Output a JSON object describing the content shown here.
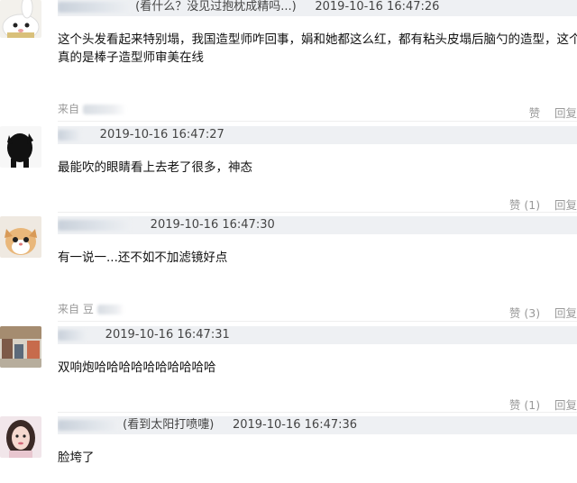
{
  "comments": [
    {
      "nickname": "(看什么？没见过抱枕成精吗...)",
      "time": "2019-10-16 16:47:26",
      "text_line1": "这个头发看起来特别塌，我国造型师咋回事，娟和她都这么红，都有粘头皮塌后脑勺的造型，这个",
      "text_line2": "真的是棒子造型师审美在线",
      "source_label": "来自",
      "like_label": "赞",
      "reply_label": "回复"
    },
    {
      "nickname": "",
      "time": "2019-10-16 16:47:27",
      "text_line1": "最能吹的眼睛看上去老了很多，神态",
      "like_label": "赞 (1)",
      "reply_label": "回复"
    },
    {
      "nickname": "",
      "time": "2019-10-16 16:47:30",
      "text_line1": "有一说一...还不如不加滤镜好点",
      "source_label": "来自 豆",
      "like_label": "赞 (3)",
      "reply_label": "回复"
    },
    {
      "nickname": "",
      "time": "2019-10-16 16:47:31",
      "text_line1": "双响炮哈哈哈哈哈哈哈哈哈哈",
      "like_label": "赞 (1)",
      "reply_label": "回复"
    },
    {
      "nickname": "(看到太阳打喷嚏)",
      "time": "2019-10-16 16:47:36",
      "text_line1": "脸垮了"
    }
  ],
  "icons": [
    "bunny-plush-avatar-icon",
    "black-cat-avatar-icon",
    "cat-avatar-icon",
    "street-avatar-icon",
    "girl-avatar-icon"
  ],
  "colors": {
    "header_bar": "#eef0f3",
    "meta_text": "#999999",
    "body_text": "#111111"
  }
}
